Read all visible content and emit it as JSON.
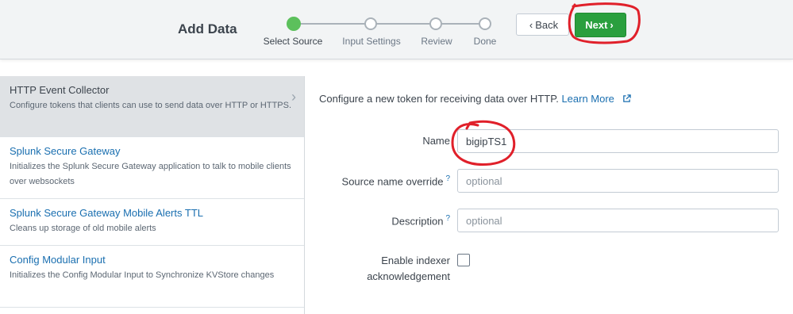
{
  "header": {
    "title": "Add Data",
    "steps": [
      "Select Source",
      "Input Settings",
      "Review",
      "Done"
    ],
    "active_step": 0,
    "back_label": "Back",
    "next_label": "Next",
    "accent_color": "#5cc05c",
    "next_color": "#2a9f3e"
  },
  "sources": [
    {
      "title": "HTTP Event Collector",
      "description": "Configure tokens that clients can use to send data over HTTP or HTTPS.",
      "selected": true
    },
    {
      "title": "Splunk Secure Gateway",
      "description": "Initializes the Splunk Secure Gateway application to talk to mobile clients over websockets",
      "selected": false
    },
    {
      "title": "Splunk Secure Gateway Mobile Alerts TTL",
      "description": "Cleans up storage of old mobile alerts",
      "selected": false
    },
    {
      "title": "Config Modular Input",
      "description": "Initializes the Config Modular Input to Synchronize KVStore changes",
      "selected": false
    }
  ],
  "form": {
    "intro": "Configure a new token for receiving data over HTTP.",
    "learn_more": "Learn More",
    "name_label": "Name",
    "name_value": "bigipTS1",
    "source_label": "Source name override",
    "source_placeholder": "optional",
    "description_label": "Description",
    "description_placeholder": "optional",
    "ack_label": "Enable indexer acknowledgement",
    "ack_checked": false,
    "help_mark": "?"
  },
  "annotation_color": "#e0202a"
}
